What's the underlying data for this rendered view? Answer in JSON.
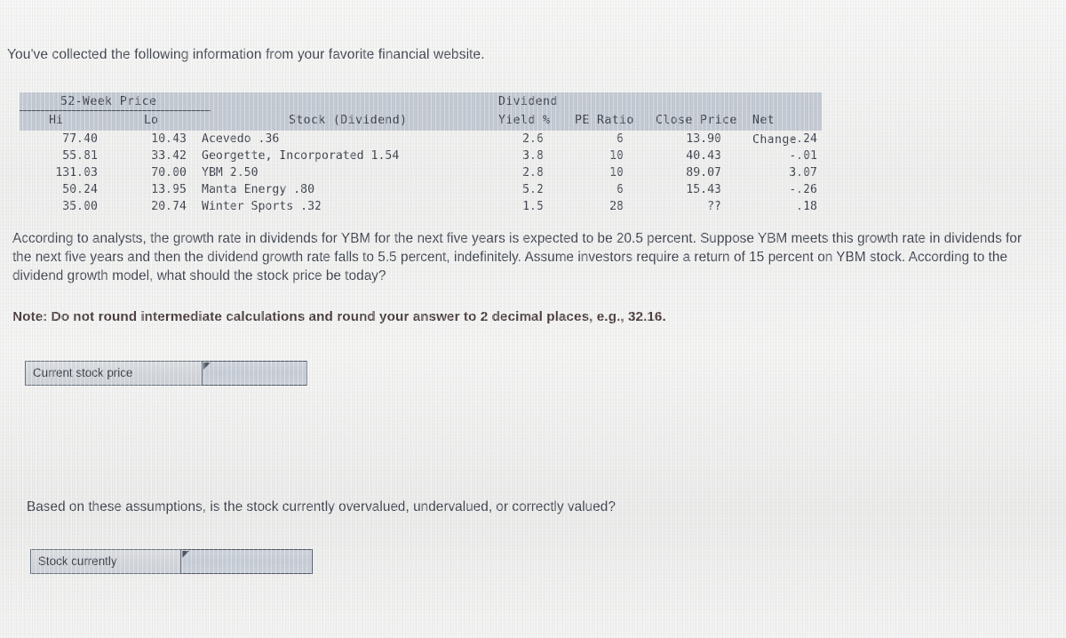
{
  "intro": {
    "text": "You've collected the following information from your favorite financial website."
  },
  "quote_table": {
    "group_headers": {
      "price_group": "52-Week Price",
      "dividend_group": "Dividend"
    },
    "columns": {
      "hi": "Hi",
      "lo": "Lo",
      "stock": "Stock (Dividend)",
      "yield": "Yield %",
      "pe_ratio": "PE Ratio",
      "close_price": "Close Price",
      "net_change": "Net Change"
    },
    "rows": [
      {
        "hi": "77.40",
        "lo": "10.43",
        "stock": "Acevedo .36",
        "yield": "2.6",
        "pe_ratio": "6",
        "close_price": "13.90",
        "net_change": "-.24"
      },
      {
        "hi": "55.81",
        "lo": "33.42",
        "stock": "Georgette, Incorporated 1.54",
        "yield": "3.8",
        "pe_ratio": "10",
        "close_price": "40.43",
        "net_change": "-.01"
      },
      {
        "hi": "131.03",
        "lo": "70.00",
        "stock": "YBM 2.50",
        "yield": "2.8",
        "pe_ratio": "10",
        "close_price": "89.07",
        "net_change": "3.07"
      },
      {
        "hi": "50.24",
        "lo": "13.95",
        "stock": "Manta Energy .80",
        "yield": "5.2",
        "pe_ratio": "6",
        "close_price": "15.43",
        "net_change": "-.26"
      },
      {
        "hi": "35.00",
        "lo": "20.74",
        "stock": "Winter Sports .32",
        "yield": "1.5",
        "pe_ratio": "28",
        "close_price": "??",
        "net_change": ".18"
      }
    ]
  },
  "question_1": {
    "body": "According to analysts, the growth rate in dividends for YBM for the next five years is expected to be 20.5 percent. Suppose YBM meets this growth rate in dividends for the next five years and then the dividend growth rate falls to 5.5 percent, indefinitely. Assume investors require a return of 15 percent on YBM stock. According to the dividend growth model, what should the stock price be today?",
    "note": "Note: Do not round intermediate calculations and round your answer to 2 decimal places, e.g., 32.16.",
    "answer_label": "Current stock price",
    "answer_value": "",
    "answer_placeholder": ""
  },
  "question_2": {
    "body": "Based on these assumptions, is the stock currently overvalued, undervalued, or correctly valued?",
    "answer_label": "Stock currently",
    "answer_value": "",
    "answer_placeholder": ""
  },
  "colors": {
    "page_background": "#f2f2f1",
    "body_text": "#3f444e",
    "note_text": "#4a3c3e",
    "table_header_fill": "#c4cad3",
    "table_text": "#3c414b",
    "input_border": "#4e5663",
    "input_fill": "#c9cfd8",
    "label_fill": "#d4d7dc"
  }
}
